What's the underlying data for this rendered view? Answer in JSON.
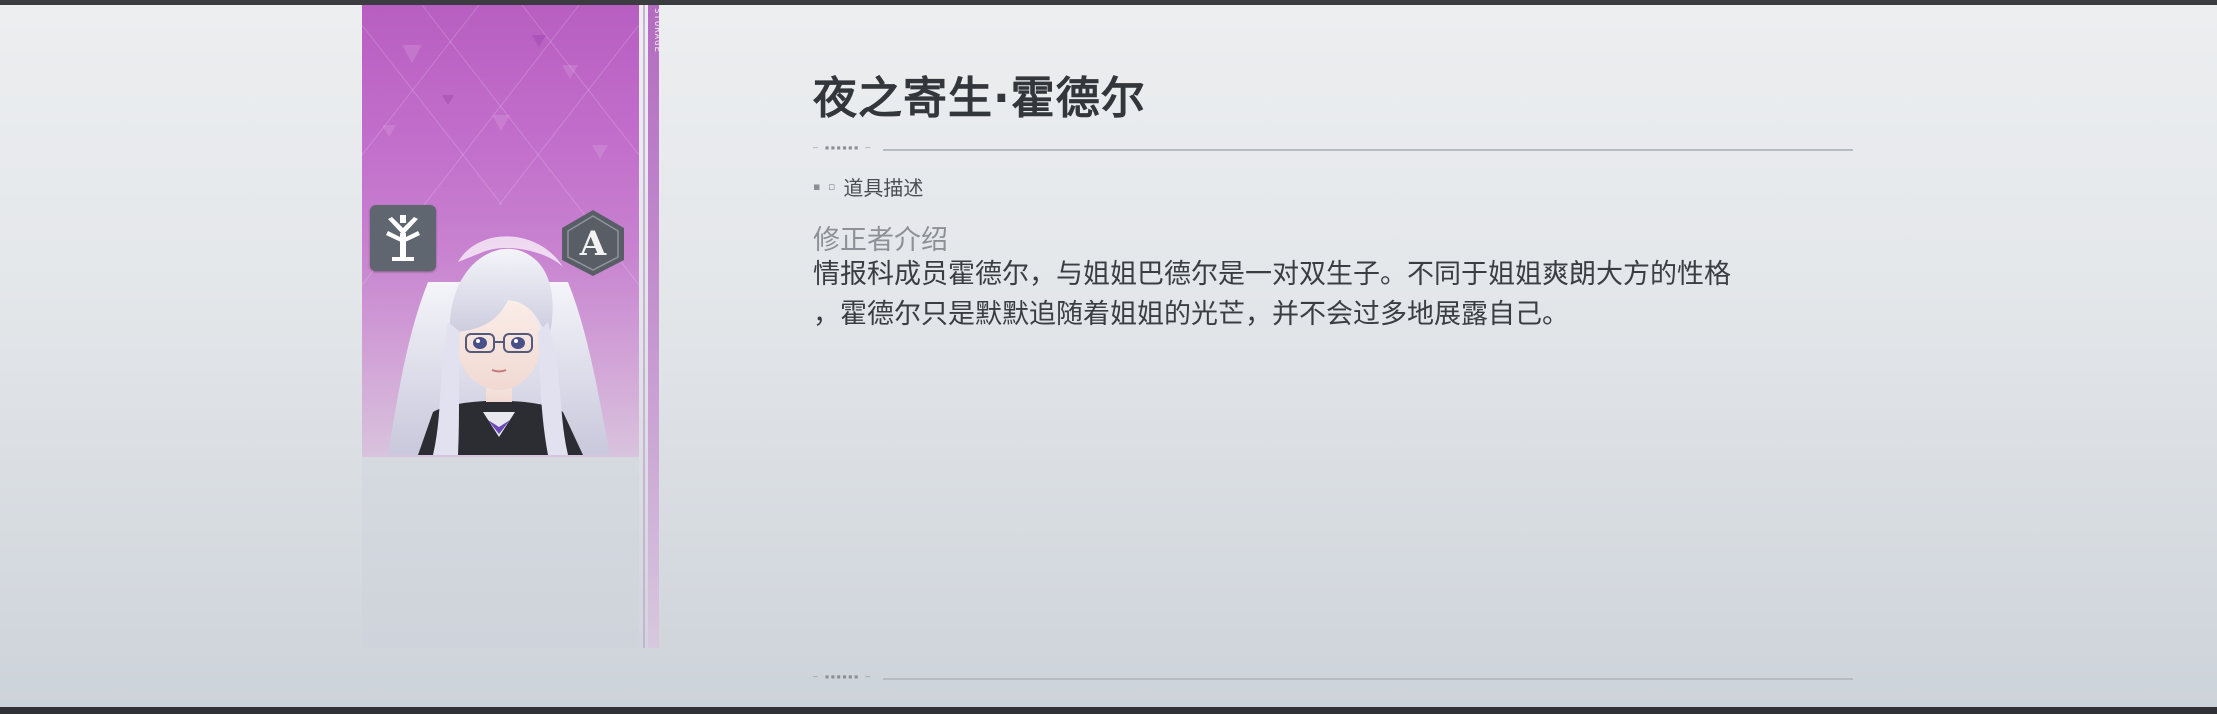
{
  "item": {
    "name": "夜之寄生·霍德尔",
    "rarity_color": "#c070c8",
    "class_icon": "tree-class-icon",
    "rank_icon": "rank-a-badge-icon",
    "rank_letter": "A"
  },
  "stripe": {
    "label": "STORAGE"
  },
  "divider": {
    "tag": "— ▪▪▪▪▪▪ —"
  },
  "section": {
    "marks": "▪ ▫",
    "label": "道具描述"
  },
  "description": {
    "subheading": "修正者介绍",
    "text": "情报科成员霍德尔，与姐姐巴德尔是一对双生子。不同于姐姐爽朗大方的性格\n，霍德尔只是默默追随着姐姐的光芒，并不会过多地展露自己。"
  }
}
